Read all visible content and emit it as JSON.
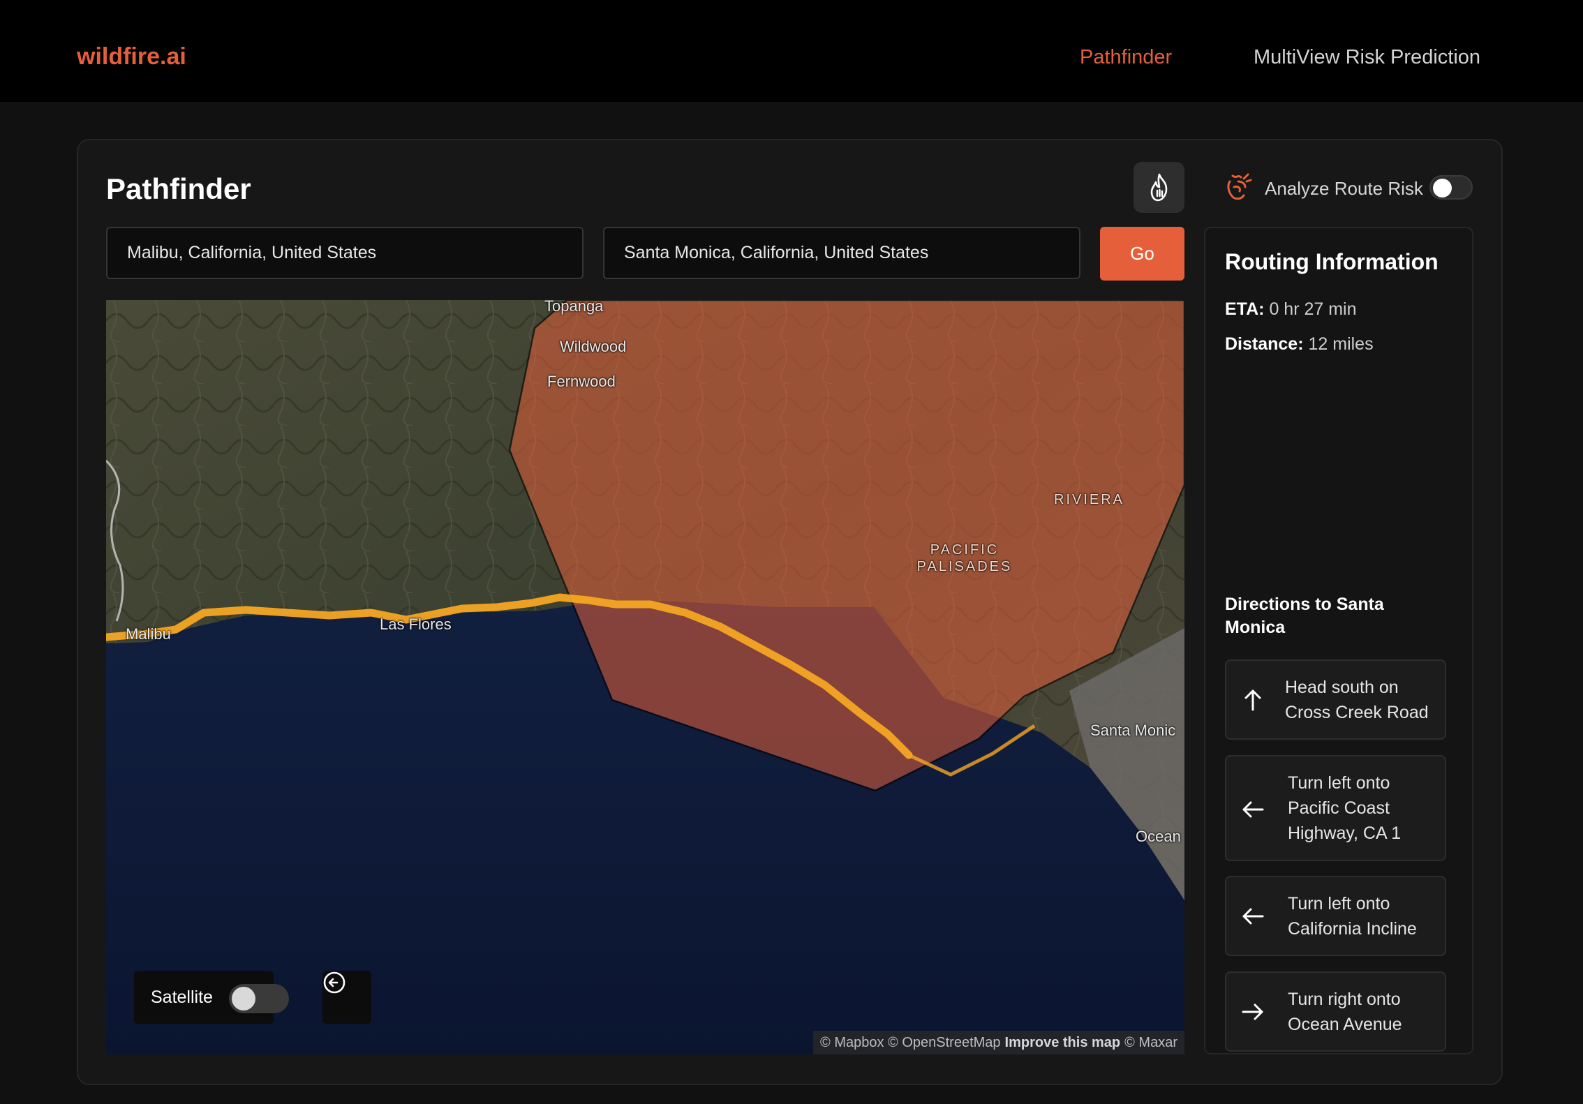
{
  "brand": "wildfire.ai",
  "nav": {
    "pathfinder": "Pathfinder",
    "multiview": "MultiView Risk Prediction"
  },
  "page_title": "Pathfinder",
  "risk": {
    "label": "Analyze Route Risk",
    "enabled": false
  },
  "inputs": {
    "origin": "Malibu, California, United States",
    "destination": "Santa Monica, California, United States"
  },
  "go_label": "Go",
  "map": {
    "places": [
      "Topanga",
      "Wildwood",
      "Fernwood",
      "RIVIERA",
      "PACIFIC PALISADES",
      "Malibu",
      "Las Flores",
      "Santa Monic",
      "Ocean"
    ],
    "satellite_label": "Satellite",
    "satellite_enabled": false,
    "attribution": {
      "mapbox": "© Mapbox",
      "osm": "© OpenStreetMap",
      "improve": "Improve this map",
      "maxar": "© Maxar"
    },
    "colors": {
      "route": "#f5a623",
      "risk_zone": "#e5603a"
    }
  },
  "routing": {
    "title": "Routing Information",
    "eta_label": "ETA:",
    "eta_value": "0 hr 27 min",
    "distance_label": "Distance:",
    "distance_value": "12 miles",
    "directions_title": "Directions to Santa Monica",
    "steps": [
      {
        "icon": "arrow-up-icon",
        "line1": "Head south on",
        "line2": "Cross Creek Road",
        "line3": ""
      },
      {
        "icon": "arrow-left-icon",
        "line1": "Turn left onto",
        "line2": "Pacific Coast",
        "line3": "Highway, CA 1"
      },
      {
        "icon": "arrow-left-icon",
        "line1": "Turn left onto",
        "line2": "California Incline",
        "line3": ""
      },
      {
        "icon": "arrow-right-icon",
        "line1": "Turn right onto",
        "line2": "Ocean Avenue",
        "line3": ""
      }
    ]
  }
}
